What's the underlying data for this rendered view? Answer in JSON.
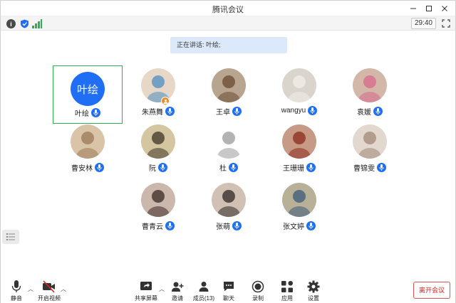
{
  "window": {
    "title": "腾讯会议",
    "timer": "29:40"
  },
  "banner": {
    "text": "正在讲话: 叶绘;"
  },
  "participants": [
    {
      "name": "叶绘",
      "avatar_text": "叶绘",
      "active": true
    },
    {
      "name": "朱燕舞",
      "host": true
    },
    {
      "name": "王卓"
    },
    {
      "name": "wangyu"
    },
    {
      "name": "袁媛"
    },
    {
      "name": "曹安林"
    },
    {
      "name": "阮"
    },
    {
      "name": "杜"
    },
    {
      "name": "王珊珊"
    },
    {
      "name": "曹锦雯"
    },
    {
      "name": "曹青云"
    },
    {
      "name": "张萌"
    },
    {
      "name": "张文婷"
    }
  ],
  "toolbar": {
    "mute": "静音",
    "video": "开启视频",
    "share": "共享屏幕",
    "invite": "邀请",
    "members": "成员(13)",
    "chat": "聊天",
    "record": "录制",
    "apps": "应用",
    "settings": "设置",
    "leave": "离开会议"
  },
  "colors": {
    "accent": "#1f6ef5",
    "active_border": "#2bb24c",
    "leave": "#e02020",
    "banner_bg": "#dce9fb"
  }
}
